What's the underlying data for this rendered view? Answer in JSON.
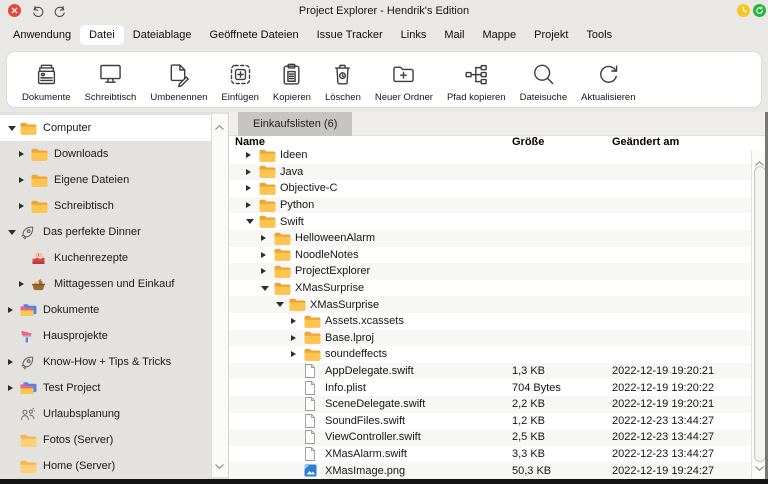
{
  "window": {
    "title": "Project Explorer - Hendrik's Edition",
    "controls": {
      "left": [
        {
          "name": "close",
          "icon": "close"
        },
        {
          "name": "undo",
          "icon": "undo"
        },
        {
          "name": "redo",
          "icon": "redo"
        }
      ],
      "right": [
        {
          "name": "pending-status",
          "icon": "clock-badge"
        },
        {
          "name": "online-status",
          "icon": "sync-badge"
        }
      ]
    }
  },
  "menu": {
    "active_index": 1,
    "items": [
      "Anwendung",
      "Datei",
      "Dateiablage",
      "Geöffnete Dateien",
      "Issue Tracker",
      "Links",
      "Mail",
      "Mappe",
      "Projekt",
      "Tools"
    ]
  },
  "toolbar": {
    "items": [
      {
        "label": "Dokumente",
        "icon": "documents"
      },
      {
        "label": "Schreibtisch",
        "icon": "desktop"
      },
      {
        "label": "Umbenennen",
        "icon": "rename"
      },
      {
        "label": "Einfügen",
        "icon": "paste"
      },
      {
        "label": "Kopieren",
        "icon": "copy"
      },
      {
        "label": "Löschen",
        "icon": "trash"
      },
      {
        "label": "Neuer Ordner",
        "icon": "new-folder"
      },
      {
        "label": "Pfad kopieren",
        "icon": "copy-path"
      },
      {
        "label": "Dateisuche",
        "icon": "search"
      },
      {
        "label": "Aktualisieren",
        "icon": "refresh"
      }
    ]
  },
  "sidebar": {
    "items": [
      {
        "label": "Computer",
        "icon": "folder",
        "arrow": "down",
        "level": 0,
        "selected": true
      },
      {
        "label": "Downloads",
        "icon": "folder",
        "arrow": "right",
        "level": 1,
        "selected": false
      },
      {
        "label": "Eigene Dateien",
        "icon": "folder",
        "arrow": "right",
        "level": 1,
        "selected": false
      },
      {
        "label": "Schreibtisch",
        "icon": "folder",
        "arrow": "right",
        "level": 1,
        "selected": false
      },
      {
        "label": "Das perfekte Dinner",
        "icon": "rocket",
        "arrow": "down",
        "level": 0,
        "selected": false
      },
      {
        "label": "Kuchenrezepte",
        "icon": "cake",
        "arrow": "none",
        "level": 1,
        "selected": false
      },
      {
        "label": "Mittagessen und Einkauf",
        "icon": "meal",
        "arrow": "right",
        "level": 1,
        "selected": false
      },
      {
        "label": "Dokumente",
        "icon": "project-folders",
        "arrow": "right",
        "level": 0,
        "selected": false
      },
      {
        "label": "Hausprojekte",
        "icon": "paintbrush",
        "arrow": "none",
        "level": 0,
        "selected": false
      },
      {
        "label": "Know-How + Tips & Tricks",
        "icon": "rocket",
        "arrow": "right",
        "level": 0,
        "selected": false
      },
      {
        "label": "Test Project",
        "icon": "project-folders",
        "arrow": "right",
        "level": 0,
        "selected": false
      },
      {
        "label": "Urlaubsplanung",
        "icon": "people",
        "arrow": "none",
        "level": 0,
        "selected": false
      },
      {
        "label": "Fotos (Server)",
        "icon": "folder-plain",
        "arrow": "none",
        "level": 0,
        "selected": false
      },
      {
        "label": "Home (Server)",
        "icon": "folder-plain",
        "arrow": "none",
        "level": 0,
        "selected": false
      }
    ]
  },
  "main": {
    "tab_label": "Einkaufslisten (6)",
    "columns": {
      "name": "Name",
      "size": "Größe",
      "modified": "Geändert am"
    },
    "rows": [
      {
        "name": "Ideen",
        "icon": "folder",
        "arrow": "right",
        "level": 1,
        "size": "",
        "modified": ""
      },
      {
        "name": "Java",
        "icon": "folder",
        "arrow": "right",
        "level": 1,
        "size": "",
        "modified": ""
      },
      {
        "name": "Objective-C",
        "icon": "folder",
        "arrow": "right",
        "level": 1,
        "size": "",
        "modified": ""
      },
      {
        "name": "Python",
        "icon": "folder",
        "arrow": "right",
        "level": 1,
        "size": "",
        "modified": ""
      },
      {
        "name": "Swift",
        "icon": "folder",
        "arrow": "down",
        "level": 1,
        "size": "",
        "modified": ""
      },
      {
        "name": "HelloweenAlarm",
        "icon": "folder",
        "arrow": "right",
        "level": 2,
        "size": "",
        "modified": ""
      },
      {
        "name": "NoodleNotes",
        "icon": "folder",
        "arrow": "right",
        "level": 2,
        "size": "",
        "modified": ""
      },
      {
        "name": "ProjectExplorer",
        "icon": "folder",
        "arrow": "right",
        "level": 2,
        "size": "",
        "modified": ""
      },
      {
        "name": "XMasSurprise",
        "icon": "folder",
        "arrow": "down",
        "level": 2,
        "size": "",
        "modified": ""
      },
      {
        "name": "XMasSurprise",
        "icon": "folder",
        "arrow": "down",
        "level": 3,
        "size": "",
        "modified": ""
      },
      {
        "name": "Assets.xcassets",
        "icon": "folder",
        "arrow": "right",
        "level": 4,
        "size": "",
        "modified": ""
      },
      {
        "name": "Base.lproj",
        "icon": "folder",
        "arrow": "right",
        "level": 4,
        "size": "",
        "modified": ""
      },
      {
        "name": "soundeffects",
        "icon": "folder",
        "arrow": "right",
        "level": 4,
        "size": "",
        "modified": ""
      },
      {
        "name": "AppDelegate.swift",
        "icon": "file",
        "arrow": "none",
        "level": 4,
        "size": "1,3 KB",
        "modified": "2022-12-19 19:20:21"
      },
      {
        "name": "Info.plist",
        "icon": "file",
        "arrow": "none",
        "level": 4,
        "size": "704 Bytes",
        "modified": "2022-12-19 19:20:22"
      },
      {
        "name": "SceneDelegate.swift",
        "icon": "file",
        "arrow": "none",
        "level": 4,
        "size": "2,2 KB",
        "modified": "2022-12-19 19:20:21"
      },
      {
        "name": "SoundFiles.swift",
        "icon": "file",
        "arrow": "none",
        "level": 4,
        "size": "1,2 KB",
        "modified": "2022-12-23 13:44:27"
      },
      {
        "name": "ViewController.swift",
        "icon": "file",
        "arrow": "none",
        "level": 4,
        "size": "2,5 KB",
        "modified": "2022-12-23 13:44:27"
      },
      {
        "name": "XMasAlarm.swift",
        "icon": "file",
        "arrow": "none",
        "level": 4,
        "size": "3,3 KB",
        "modified": "2022-12-23 13:44:27"
      },
      {
        "name": "XMasImage.png",
        "icon": "image",
        "arrow": "none",
        "level": 4,
        "size": "50,3 KB",
        "modified": "2022-12-19 19:24:27"
      }
    ]
  },
  "colors": {
    "chrome-bg": "#e9e8e5",
    "sidebar-bg": "#e3e2df",
    "menu-active-bg": "#ffffff",
    "toolbar-bg": "#ffffff",
    "tabbar-bg": "#efeeec",
    "tab-bg": "#c6c5c3",
    "row-stripe": "#f7f7f6",
    "selected-row-bg": "#ffffff",
    "folder-yellow": "#fec44f",
    "close-red": "#e8453c",
    "pending-yellow": "#f6c628",
    "active-green": "#27b43e"
  }
}
